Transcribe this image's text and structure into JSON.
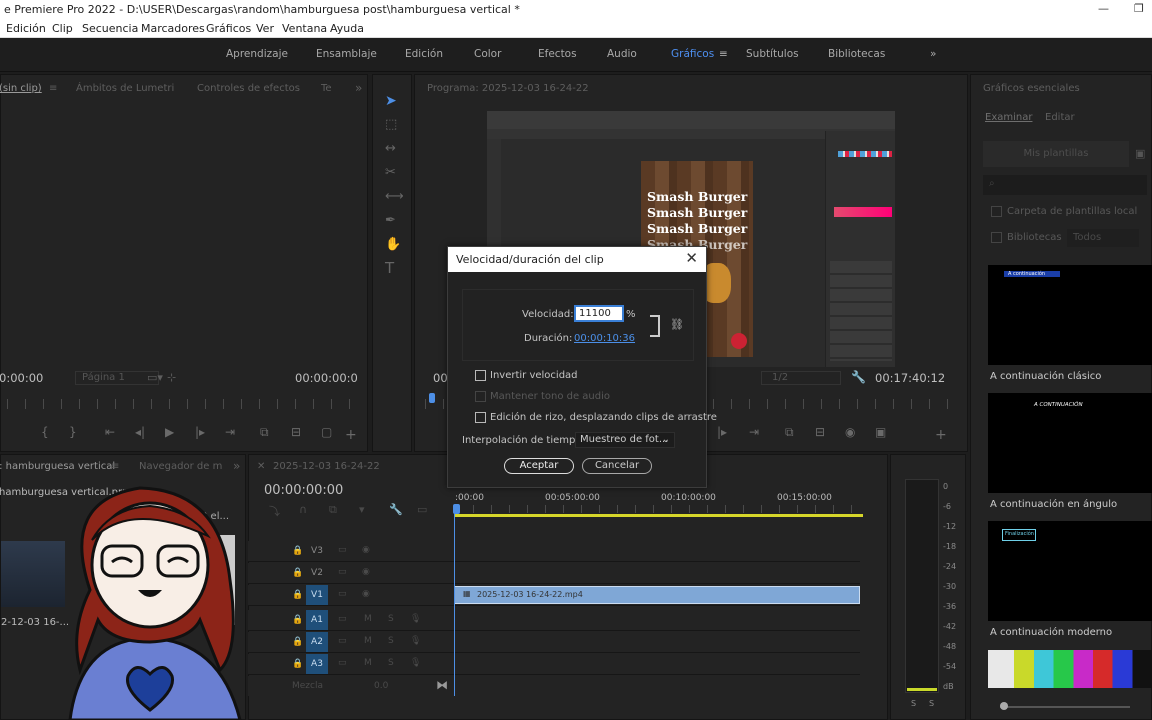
{
  "window": {
    "title": "e Premiere Pro 2022 - D:\\USER\\Descargas\\random\\hamburguesa post\\hamburguesa vertical *",
    "minimize": "—",
    "restore": "❐"
  },
  "menu": [
    "Edición",
    "Clip",
    "Secuencia",
    "Marcadores",
    "Gráficos",
    "Ver",
    "Ventana",
    "Ayuda"
  ],
  "workspaces": [
    "Aprendizaje",
    "Ensamblaje",
    "Edición",
    "Color",
    "Efectos",
    "Audio",
    "Gráficos",
    "Subtítulos",
    "Bibliotecas"
  ],
  "workspace_active": "Gráficos",
  "workspace_menu_icon": "≡",
  "workspace_more": "»",
  "source_panel": {
    "tabs": [
      "(sin clip)",
      "Ámbitos de Lumetri",
      "Controles de efectos",
      "Te"
    ],
    "more": "»",
    "timecode_left": "0:00:00",
    "page": "Página 1",
    "timecode_right": "00:00:00:0"
  },
  "program_panel": {
    "tab": "Programa: 2025-12-03 16-24-22",
    "timecode_left": "00",
    "fraction": "1/2",
    "timecode_right": "00:17:40:12",
    "burger_lines": [
      "Smash Burger",
      "Smash Burger",
      "Smash Burger",
      "Smash Burger"
    ]
  },
  "project_panel": {
    "tabs": [
      "o: hamburguesa vertical",
      "Navegador de m"
    ],
    "file": "hamburguesa vertical.prproj",
    "item_text": "2 el...",
    "clip_name": "2-12-03 16-..."
  },
  "timeline": {
    "tab": "2025-12-03 16-24-22",
    "timecode": "00:00:00:00",
    "ruler_labels": [
      ":00:00",
      "00:05:00:00",
      "00:10:00:00",
      "00:15:00:00"
    ],
    "video_tracks": [
      "V3",
      "V2",
      "V1"
    ],
    "audio_tracks": [
      "A1",
      "A2",
      "A3"
    ],
    "mix_label": "Mezcla",
    "mix_value": "0.0",
    "clip_label": "2025-12-03 16-24-22.mp4"
  },
  "meter_labels": [
    "0",
    "-6",
    "-12",
    "-18",
    "-24",
    "-30",
    "-36",
    "-42",
    "-48",
    "-54",
    "dB"
  ],
  "meter_solo": [
    "S",
    "S"
  ],
  "dialog": {
    "title": "Velocidad/duración del clip",
    "close": "✕",
    "speed_label": "Velocidad:",
    "speed_value": "11100",
    "speed_unit": "%",
    "duration_label": "Duración:",
    "duration_value": "00:00:10:36",
    "reverse": "Invertir velocidad",
    "maintain_pitch": "Mantener tono de audio",
    "ripple": "Edición de rizo, desplazando clips de arrastre",
    "interp_label": "Interpolación de tiempo:",
    "interp_value": "Muestreo de fot...",
    "ok": "Aceptar",
    "cancel": "Cancelar"
  },
  "essential_graphics": {
    "title": "Gráficos esenciales",
    "tabs": [
      "Examinar",
      "Editar"
    ],
    "my_templates": "Mis plantillas",
    "local_templates": "Carpeta de plantillas local",
    "libraries": "Bibliotecas",
    "all": "Todos",
    "templates": [
      {
        "name": "A continuación clásico",
        "preview": "A continuación"
      },
      {
        "name": "A continuación en ángulo",
        "preview": "A CONTINUACIÓN"
      },
      {
        "name": "A continuación moderno",
        "preview": "Finalización"
      }
    ]
  }
}
